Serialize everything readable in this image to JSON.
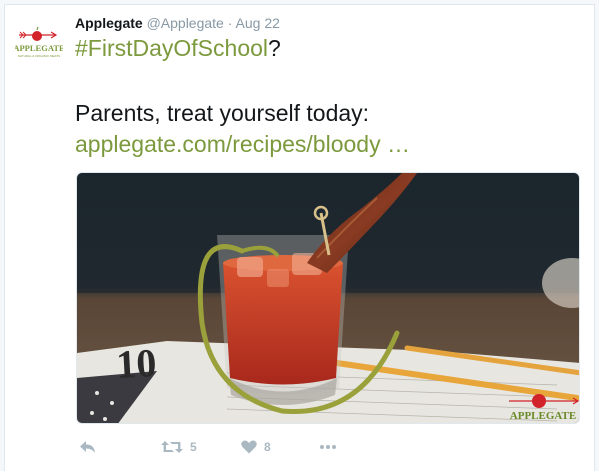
{
  "tweet": {
    "author_name": "Applegate",
    "author_handle": "@Applegate",
    "separator": "·",
    "date": "Aug 22",
    "hashtag": "#FirstDayOfSchool",
    "hashtag_suffix": "?",
    "body_line": "Parents, treat yourself today:",
    "link_text": "applegate.com/recipes/bloody …"
  },
  "avatar": {
    "logo_text": "APPLEGATE",
    "tagline": "NATURAL & ORGANIC MEATS"
  },
  "photo": {
    "watermark": "APPLEGATE",
    "newspaper_number": "10"
  },
  "actions": {
    "reply_icon": "reply-icon",
    "retweet_icon": "retweet-icon",
    "retweet_count": "5",
    "like_icon": "heart-icon",
    "like_count": "8",
    "more_icon": "more-icon"
  },
  "colors": {
    "hashtag": "#7c9a3d",
    "brand_red": "#d2232a",
    "icon_gray": "#aab8c2"
  }
}
